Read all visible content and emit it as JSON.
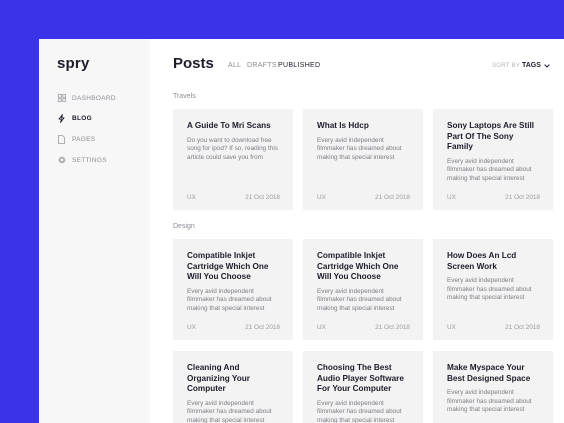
{
  "app": {
    "logo": "spry"
  },
  "sidebar": {
    "items": [
      {
        "label": "DASHBOARD",
        "icon": "grid-icon"
      },
      {
        "label": "BLOG",
        "icon": "bolt-icon"
      },
      {
        "label": "PAGES",
        "icon": "file-icon"
      },
      {
        "label": "SETTINGS",
        "icon": "gear-icon"
      }
    ]
  },
  "header": {
    "title": "Posts",
    "filters": [
      "ALL",
      "DRAFTS",
      "PUBLISHED"
    ],
    "active_filter": "PUBLISHED",
    "sort_label": "SORT BY",
    "sort_value": "TAGS"
  },
  "sections": [
    {
      "label": "Travels",
      "cards": [
        {
          "title": "A Guide To Mri Scans",
          "excerpt": "Do you want to download free song for ipod? If so, reading this article could save you from",
          "tag": "UX",
          "date": "21 Oct 2018"
        },
        {
          "title": "What Is Hdcp",
          "excerpt": "Every avid independent filmmaker has dreamed about making that special interest",
          "tag": "UX",
          "date": "21 Oct 2018"
        },
        {
          "title": "Sony Laptops Are Still Part Of The Sony Family",
          "excerpt": "Every avid independent filmmaker has dreamed about making that special interest",
          "tag": "UX",
          "date": "21 Oct 2018"
        }
      ]
    },
    {
      "label": "Design",
      "cards": [
        {
          "title": "Compatible Inkjet Cartridge Which One Will You Choose",
          "excerpt": "Every avid independent filmmaker has dreamed about making that special interest",
          "tag": "UX",
          "date": "21 Oct 2018"
        },
        {
          "title": "Compatible Inkjet Cartridge Which One Will You Choose",
          "excerpt": "Every avid independent filmmaker has dreamed about making that special interest",
          "tag": "UX",
          "date": "21 Oct 2018"
        },
        {
          "title": "How Does An Lcd Screen Work",
          "excerpt": "Every avid independent filmmaker has dreamed about making that special interest",
          "tag": "UX",
          "date": "21 Oct 2018"
        },
        {
          "title": "Cleaning And Organizing Your Computer",
          "excerpt": "Every avid independent filmmaker has dreamed about making that special interest",
          "tag": "",
          "date": ""
        },
        {
          "title": "Choosing The Best Audio Player Software For Your Computer",
          "excerpt": "Every avid independent filmmaker has dreamed about making that special interest",
          "tag": "",
          "date": ""
        },
        {
          "title": "Make Myspace Your Best Designed Space",
          "excerpt": "Every avid independent filmmaker has dreamed about making that special interest",
          "tag": "",
          "date": ""
        }
      ]
    }
  ],
  "colors": {
    "background": "#3a33ea",
    "sidebar": "#f7f7f7",
    "card": "#f3f3f3",
    "text": "#1d1d2b"
  }
}
